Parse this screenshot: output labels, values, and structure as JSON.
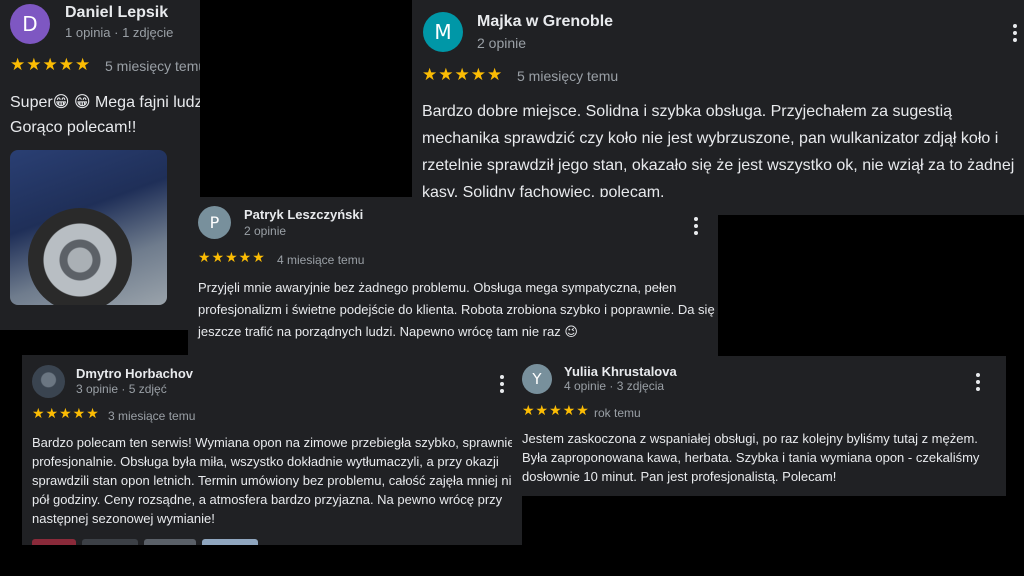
{
  "reviews": [
    {
      "initial": "D",
      "name": "Daniel Lepsik",
      "meta": "1 opinia · 1 zdjęcie",
      "stars": "★★★★★",
      "rating": 5,
      "date": "5 miesięcy temu",
      "text": "Super😁 😁 Mega fajni ludzie, bardzo pomocni. Gorąco polecam!!",
      "avatar_color": "#7e57c2"
    },
    {
      "initial": "M",
      "name": "Majka w Grenoble",
      "meta": "2 opinie",
      "stars": "★★★★★",
      "rating": 5,
      "date": "5 miesięcy temu",
      "text": "Bardzo dobre miejsce. Solidna i szybka obsługa. Przyjechałem za sugestią mechanika sprawdzić czy koło nie jest wybrzuszone, pan wulkanizator zdjął koło i rzetelnie sprawdził jego stan, okazało się że jest wszystko ok, nie wziął za to żadnej kasy. Solidny fachowiec, polecam.",
      "avatar_color": "#0097a7"
    },
    {
      "initial": "P",
      "name": "Patryk Leszczyński",
      "meta": "2 opinie",
      "stars": "★★★★★",
      "rating": 5,
      "date": "4 miesiące temu",
      "text": "Przyjęli mnie awaryjnie bez żadnego problemu. Obsługa mega sympatyczna, pełen profesjonalizm i świetne podejście do klienta. Robota zrobiona szybko i poprawnie. Da się jeszcze trafić na porządnych ludzi. Napewno wrócę tam nie raz 😉",
      "avatar_color": "#78909c"
    },
    {
      "initial": "",
      "name": "Dmytro Horbachov",
      "meta": "3 opinie · 5 zdjęć",
      "stars": "★★★★★",
      "rating": 5,
      "date": "3 miesiące temu",
      "text": "Bardzo polecam ten serwis! Wymiana opon na zimowe przebiegła szybko, sprawnie i profesjonalnie. Obsługa była miła, wszystko dokładnie wytłumaczyli, a przy okazji sprawdzili stan opon letnich. Termin umówiony bez problemu, całość zajęła mniej niż pół godziny. Ceny rozsądne, a atmosfera bardzo przyjazna. Na pewno wrócę przy następnej sezonowej wymianie!"
    },
    {
      "initial": "Y",
      "name": "Yuliia Khrustalova",
      "meta": "4 opinie · 3 zdjęcia",
      "stars": "★★★★★",
      "rating": 5,
      "date": "rok temu",
      "text": "Jestem zaskoczona z wspaniałej obsługi, po raz kolejny byliśmy tutaj z mężem. Była zaproponowana kawa, herbata. Szybka i tania wymiana opon - czekaliśmy dosłownie 10 minut. Pan jest profesjonalistą. Polecam!",
      "avatar_color": "#78909c"
    }
  ],
  "colors": {
    "background": "#000000",
    "card": "#202124",
    "star": "#fbbc04",
    "text": "#e8eaed",
    "secondary_text": "#9aa0a6"
  },
  "icons": {
    "more": "more-vert-icon",
    "star": "star-icon"
  }
}
